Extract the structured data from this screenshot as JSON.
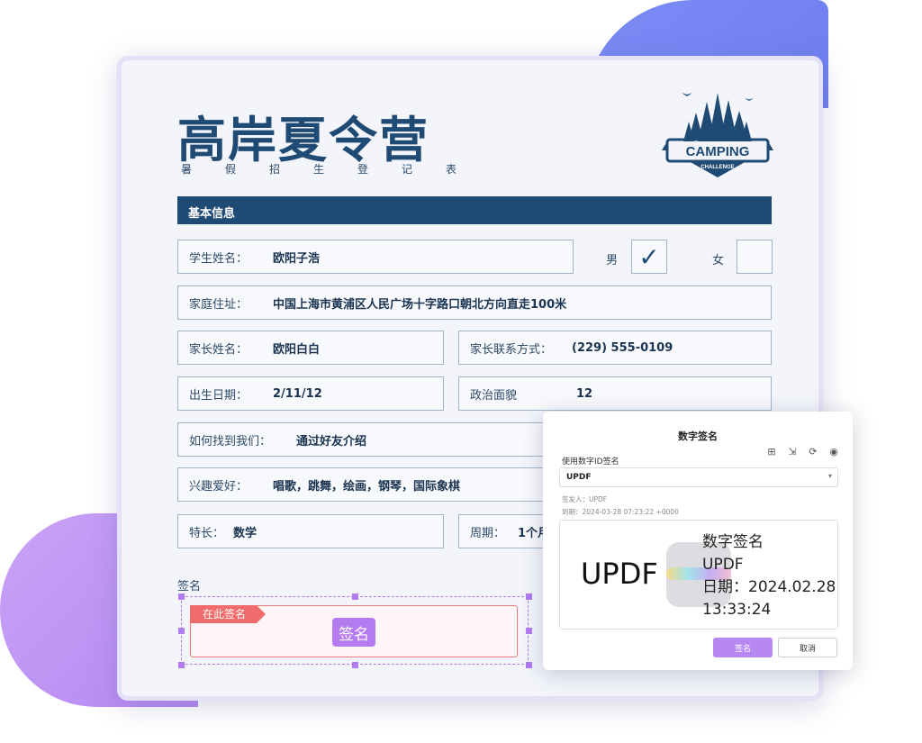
{
  "form": {
    "title": "高岸夏令营",
    "subtitle": "暑假招生登记表",
    "logo_text": "CAMPING",
    "logo_subtext": "CHALLENGE",
    "section_title": "基本信息",
    "student_name_label": "学生姓名：",
    "student_name_value": "欧阳子浩",
    "gender_male": "男",
    "gender_female": "女",
    "gender_male_checked": true,
    "gender_female_checked": false,
    "address_label": "家庭住址：",
    "address_value": "中国上海市黄浦区人民广场十字路口朝北方向直走100米",
    "parent_name_label": "家长姓名：",
    "parent_name_value": "欧阳白白",
    "parent_phone_label": "家长联系方式：",
    "parent_phone_value": "(229) 555-0109",
    "birth_label": "出生日期：",
    "birth_value": "2/11/12",
    "politics_label": "政治面貌",
    "politics_value": "12",
    "source_label": "如何找到我们：",
    "source_value": "通过好友介绍",
    "hobby_label": "兴趣爱好：",
    "hobby_value": "唱歌，跳舞，绘画，钢琴，国际象棋",
    "skill_label": "特长：",
    "skill_value": "数学",
    "period_label": "周期：",
    "period_value": "1个月",
    "signature_label": "签名",
    "sign_here_tag": "在此签名",
    "sign_button": "签名"
  },
  "dialog": {
    "title": "数字签名",
    "id_label": "使用数字ID签名",
    "selected_id": "UPDF",
    "signer": "签发人：UPDF",
    "time": "到期：2024-03-28 07:23:22 +0000",
    "preview_name": "UPDF",
    "preview_line1": "数字签名",
    "preview_line2": "UPDF",
    "preview_line3": "日期：2024.02.28",
    "preview_line4": "13:33:24",
    "sign_button": "签名",
    "cancel_button": "取消",
    "toolbar_icons": [
      "add-id-icon",
      "import-id-icon",
      "refresh-icon",
      "view-icon"
    ]
  },
  "colors": {
    "navy": "#1f4a73",
    "purple": "#b47bf0",
    "red": "#f06b6b",
    "blob_blue": "#7b8cf5",
    "blob_purple": "#c9a3f7"
  }
}
